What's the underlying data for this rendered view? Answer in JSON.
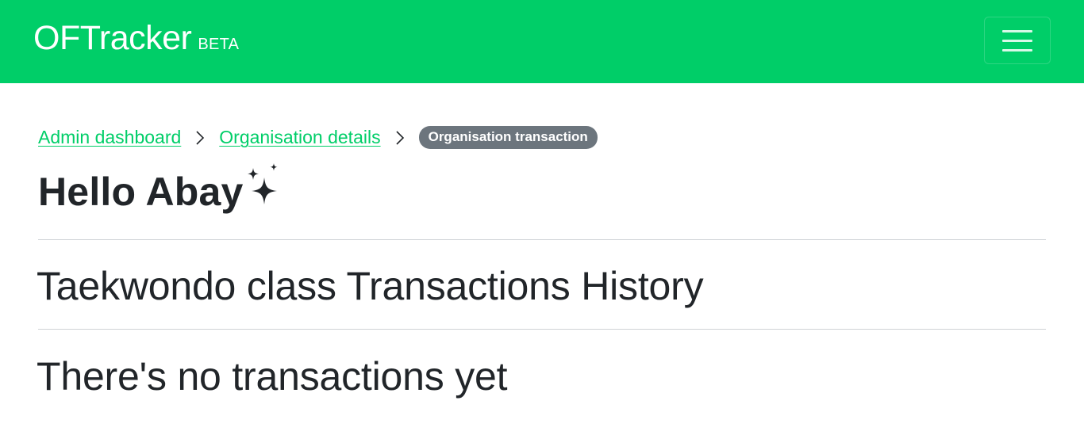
{
  "navbar": {
    "brand": "OFTracker",
    "badge": "BETA",
    "background": "#00ce68",
    "toggler_icon": "hamburger-menu-icon"
  },
  "breadcrumb": {
    "items": [
      {
        "label": "Admin dashboard"
      },
      {
        "label": "Organisation details"
      }
    ],
    "active": "Organisation transaction",
    "separator_icon": "chevron-right-icon"
  },
  "greeting": {
    "text": "Hello Abay",
    "icon": "sparkles-icon"
  },
  "main": {
    "title": "Taekwondo class Transactions History",
    "empty_message": "There's no transactions yet"
  },
  "colors": {
    "accent": "#00ce68",
    "badge_bg": "#6c757d",
    "text": "#212529"
  }
}
